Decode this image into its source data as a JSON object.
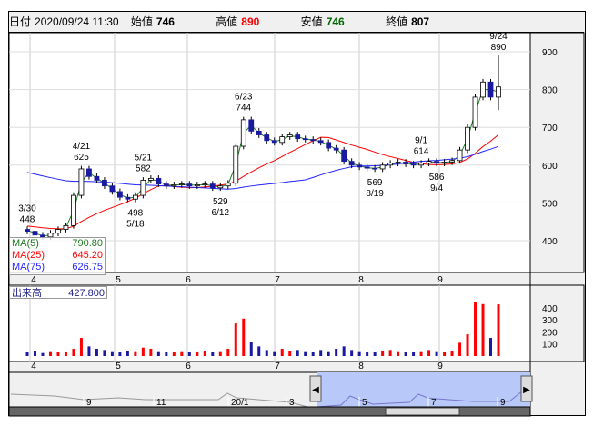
{
  "header": {
    "date_label": "日付",
    "datetime": "2020/09/24 11:30",
    "open_label": "始値",
    "open": "746",
    "high_label": "高値",
    "high": "890",
    "low_label": "安値",
    "low": "746",
    "close_label": "終値",
    "close": "807"
  },
  "colors": {
    "up": "#ffffff",
    "down": "#1a1aa0",
    "ma5": "#1e7a1e",
    "ma25": "#ff0000",
    "ma75": "#2222ff",
    "vol_up": "#ff0000",
    "vol_down": "#1a1aa0",
    "nav_fill": "#b8c8f8"
  },
  "ma_legend": [
    {
      "label": "MA(5)",
      "value": "790.80"
    },
    {
      "label": "MA(25)",
      "value": "645.20"
    },
    {
      "label": "MA(75)",
      "value": "626.75"
    }
  ],
  "volume_legend": {
    "label": "出来高",
    "value": "427.800"
  },
  "navigator": {
    "labels": [
      "9",
      "11",
      "20/1",
      "3",
      "5",
      "7",
      "9"
    ]
  },
  "chart_data": {
    "type": "candlestick",
    "price_axis": {
      "ticks": [
        900,
        800,
        700,
        600,
        500,
        400
      ],
      "ylim": [
        350,
        920
      ]
    },
    "volume_axis": {
      "ticks": [
        400,
        300,
        200,
        100
      ],
      "ylim": [
        0,
        500
      ]
    },
    "month_labels": [
      "4",
      "5",
      "6",
      "7",
      "8",
      "9"
    ],
    "closes": [
      425,
      415,
      410,
      420,
      430,
      440,
      520,
      590,
      570,
      560,
      545,
      530,
      515,
      510,
      520,
      560,
      565,
      550,
      545,
      548,
      550,
      545,
      548,
      550,
      540,
      545,
      552,
      650,
      720,
      690,
      680,
      665,
      660,
      675,
      680,
      670,
      668,
      665,
      660,
      645,
      640,
      610,
      600,
      595,
      592,
      590,
      600,
      605,
      608,
      603,
      600,
      605,
      610,
      605,
      608,
      612,
      640,
      700,
      780,
      820,
      780,
      807
    ],
    "volumes": [
      30,
      45,
      25,
      40,
      30,
      35,
      60,
      150,
      80,
      60,
      50,
      40,
      30,
      45,
      40,
      70,
      60,
      40,
      35,
      30,
      40,
      35,
      30,
      45,
      30,
      40,
      60,
      270,
      310,
      120,
      80,
      50,
      40,
      60,
      45,
      50,
      40,
      35,
      50,
      40,
      60,
      80,
      50,
      40,
      35,
      30,
      45,
      50,
      40,
      35,
      30,
      40,
      50,
      40,
      35,
      45,
      110,
      180,
      450,
      430,
      150,
      428
    ],
    "annotations": [
      {
        "i": 0,
        "date": "3/30",
        "value": "448",
        "pos": "above"
      },
      {
        "i": 7,
        "date": "4/21",
        "value": "625",
        "pos": "above"
      },
      {
        "i": 14,
        "date": "5/18",
        "value": "498",
        "pos": "below"
      },
      {
        "i": 15,
        "date": "5/21",
        "value": "582",
        "pos": "above"
      },
      {
        "i": 25,
        "date": "6/12",
        "value": "529",
        "pos": "below"
      },
      {
        "i": 28,
        "date": "6/23",
        "value": "744",
        "pos": "above"
      },
      {
        "i": 45,
        "date": "8/19",
        "value": "569",
        "pos": "below"
      },
      {
        "i": 51,
        "date": "9/1",
        "value": "614",
        "pos": "above"
      },
      {
        "i": 53,
        "date": "9/4",
        "value": "586",
        "pos": "below"
      },
      {
        "i": 61,
        "date": "9/24",
        "value": "890",
        "pos": "above"
      }
    ]
  }
}
